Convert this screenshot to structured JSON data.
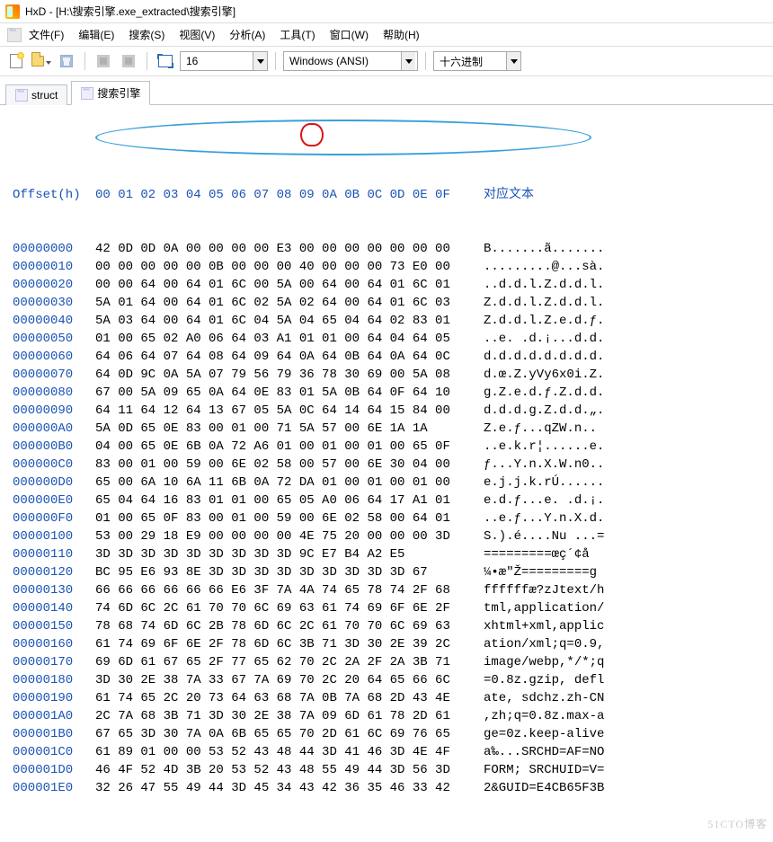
{
  "window": {
    "title": "HxD - [H:\\搜索引擎.exe_extracted\\搜索引擎]"
  },
  "menu": [
    {
      "label": "文件(F)"
    },
    {
      "label": "编辑(E)"
    },
    {
      "label": "搜索(S)"
    },
    {
      "label": "视图(V)"
    },
    {
      "label": "分析(A)"
    },
    {
      "label": "工具(T)"
    },
    {
      "label": "窗口(W)"
    },
    {
      "label": "帮助(H)"
    }
  ],
  "toolbar": {
    "bytes_per_row": "16",
    "encoding": "Windows (ANSI)",
    "base": "十六进制"
  },
  "tabs": [
    {
      "label": "struct",
      "active": false
    },
    {
      "label": "搜索引擎",
      "active": true
    }
  ],
  "hex": {
    "header_offset": "Offset(h)",
    "header_cols": "00 01 02 03 04 05 06 07 08 09 0A 0B 0C 0D 0E 0F",
    "header_text": "对应文本",
    "rows": [
      {
        "off": "00000000",
        "b": "42 0D 0D 0A 00 00 00 00 E3 00 00 00 00 00 00 00",
        "t": "B.......ã......."
      },
      {
        "off": "00000010",
        "b": "00 00 00 00 00 0B 00 00 00 40 00 00 00 73 E0 00",
        "t": ".........@...sà."
      },
      {
        "off": "00000020",
        "b": "00 00 64 00 64 01 6C 00 5A 00 64 00 64 01 6C 01",
        "t": "..d.d.l.Z.d.d.l."
      },
      {
        "off": "00000030",
        "b": "5A 01 64 00 64 01 6C 02 5A 02 64 00 64 01 6C 03",
        "t": "Z.d.d.l.Z.d.d.l."
      },
      {
        "off": "00000040",
        "b": "5A 03 64 00 64 01 6C 04 5A 04 65 04 64 02 83 01",
        "t": "Z.d.d.l.Z.e.d.ƒ."
      },
      {
        "off": "00000050",
        "b": "01 00 65 02 A0 06 64 03 A1 01 01 00 64 04 64 05",
        "t": "..e. .d.¡...d.d."
      },
      {
        "off": "00000060",
        "b": "64 06 64 07 64 08 64 09 64 0A 64 0B 64 0A 64 0C",
        "t": "d.d.d.d.d.d.d.d."
      },
      {
        "off": "00000070",
        "b": "64 0D 9C 0A 5A 07 79 56 79 36 78 30 69 00 5A 08",
        "t": "d.œ.Z.yVy6x0i.Z."
      },
      {
        "off": "00000080",
        "b": "67 00 5A 09 65 0A 64 0E 83 01 5A 0B 64 0F 64 10",
        "t": "g.Z.e.d.ƒ.Z.d.d."
      },
      {
        "off": "00000090",
        "b": "64 11 64 12 64 13 67 05 5A 0C 64 14 64 15 84 00",
        "t": "d.d.d.g.Z.d.d.„."
      },
      {
        "off": "000000A0",
        "b": "5A 0D 65 0E 83 00 01 00 71 5A 57 00 6E 1A 1A    ",
        "t": "Z.e.ƒ...qZW.n.."
      },
      {
        "off": "000000B0",
        "b": "04 00 65 0E 6B 0A 72 A6 01 00 01 00 01 00 65 0F",
        "t": "..e.k.r¦......e."
      },
      {
        "off": "000000C0",
        "b": "83 00 01 00 59 00 6E 02 58 00 57 00 6E 30 04 00",
        "t": "ƒ...Y.n.X.W.n0.."
      },
      {
        "off": "000000D0",
        "b": "65 00 6A 10 6A 11 6B 0A 72 DA 01 00 01 00 01 00",
        "t": "e.j.j.k.rÚ......"
      },
      {
        "off": "000000E0",
        "b": "65 04 64 16 83 01 01 00 65 05 A0 06 64 17 A1 01",
        "t": "e.d.ƒ...e. .d.¡."
      },
      {
        "off": "000000F0",
        "b": "01 00 65 0F 83 00 01 00 59 00 6E 02 58 00 64 01",
        "t": "..e.ƒ...Y.n.X.d."
      },
      {
        "off": "00000100",
        "b": "53 00 29 18 E9 00 00 00 00 4E 75 20 00 00 00 3D",
        "t": "S.).é....Nu ...="
      },
      {
        "off": "00000110",
        "b": "3D 3D 3D 3D 3D 3D 3D 3D 3D 9C E7 B4 A2 E5      ",
        "t": "=========œç´¢å"
      },
      {
        "off": "00000120",
        "b": "BC 95 E6 93 8E 3D 3D 3D 3D 3D 3D 3D 3D 3D 67   ",
        "t": "¼•æ\"Ž=========g"
      },
      {
        "off": "00000130",
        "b": "66 66 66 66 66 66 E6 3F 7A 4A 74 65 78 74 2F 68",
        "t": "ffffffæ?zJtext/h"
      },
      {
        "off": "00000140",
        "b": "74 6D 6C 2C 61 70 70 6C 69 63 61 74 69 6F 6E 2F",
        "t": "tml,application/"
      },
      {
        "off": "00000150",
        "b": "78 68 74 6D 6C 2B 78 6D 6C 2C 61 70 70 6C 69 63",
        "t": "xhtml+xml,applic"
      },
      {
        "off": "00000160",
        "b": "61 74 69 6F 6E 2F 78 6D 6C 3B 71 3D 30 2E 39 2C",
        "t": "ation/xml;q=0.9,"
      },
      {
        "off": "00000170",
        "b": "69 6D 61 67 65 2F 77 65 62 70 2C 2A 2F 2A 3B 71",
        "t": "image/webp,*/*;q"
      },
      {
        "off": "00000180",
        "b": "3D 30 2E 38 7A 33 67 7A 69 70 2C 20 64 65 66 6C",
        "t": "=0.8z.gzip, defl"
      },
      {
        "off": "00000190",
        "b": "61 74 65 2C 20 73 64 63 68 7A 0B 7A 68 2D 43 4E",
        "t": "ate, sdchz.zh-CN"
      },
      {
        "off": "000001A0",
        "b": "2C 7A 68 3B 71 3D 30 2E 38 7A 09 6D 61 78 2D 61",
        "t": ",zh;q=0.8z.max-a"
      },
      {
        "off": "000001B0",
        "b": "67 65 3D 30 7A 0A 6B 65 65 70 2D 61 6C 69 76 65",
        "t": "ge=0z.keep-alive"
      },
      {
        "off": "000001C0",
        "b": "61 89 01 00 00 53 52 43 48 44 3D 41 46 3D 4E 4F",
        "t": "a‰...SRCHD=AF=NO"
      },
      {
        "off": "000001D0",
        "b": "46 4F 52 4D 3B 20 53 52 43 48 55 49 44 3D 56 3D",
        "t": "FORM; SRCHUID=V="
      },
      {
        "off": "000001E0",
        "b": "32 26 47 55 49 44 3D 45 34 43 42 36 35 46 33 42",
        "t": "2&GUID=E4CB65F3B"
      }
    ]
  },
  "watermark": "51CTO博客"
}
